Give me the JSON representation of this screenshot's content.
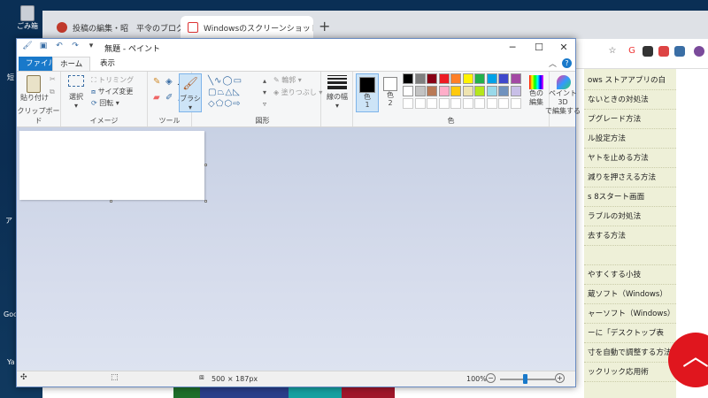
{
  "desktop": {
    "recycle_bin_label": "ごみ箱",
    "side_labels": [
      "短",
      "ア",
      "Goo",
      "Ya"
    ]
  },
  "browser": {
    "tabs": [
      {
        "title": "投稿の編集・昭　平令のブログー・",
        "active": false
      },
      {
        "title": "Windowsのスクリーンショットの撮り方",
        "active": true
      }
    ],
    "new_tab": "+"
  },
  "webpage": {
    "items": [
      "ows ストアアプリの白",
      "ないときの対処法",
      "プグレード方法",
      "ル設定方法",
      "ヤトを止める方法",
      "減りを押さえる方法",
      "s 8スタート画面",
      "ラブルの対処法",
      "去する方法",
      "",
      "やすくする小技",
      "蔵ソフト（Windows）",
      "ャーソフト（Windows）",
      "ーに「デスクトップ表",
      "寸を自動で調整する方法",
      "ックリック応用術"
    ]
  },
  "paint": {
    "title": "無題 - ペイント",
    "window_buttons": {
      "minimize": "─",
      "maximize": "☐",
      "close": "✕"
    },
    "tabs": {
      "file": "ファイル",
      "home": "ホーム",
      "view": "表示"
    },
    "ribbon": {
      "clipboard": {
        "paste": "貼り付け",
        "group": "クリップボード"
      },
      "image": {
        "select": "選択",
        "crop": "トリミング",
        "resize": "サイズ変更",
        "rotate": "回転",
        "group": "イメージ"
      },
      "tools": {
        "group": "ツール"
      },
      "brushes": {
        "label": "ブラシ"
      },
      "shapes": {
        "outline": "輪郭",
        "fill": "塗りつぶし",
        "group": "図形"
      },
      "size": {
        "label": "線の幅"
      },
      "colors": {
        "color1": "色\n1",
        "color2": "色\n2",
        "edit": "色の\n編集",
        "group": "色",
        "palette_row1": [
          "#000000",
          "#7f7f7f",
          "#880015",
          "#ed1c24",
          "#ff7f27",
          "#fff200",
          "#22b14c",
          "#00a2e8",
          "#3f48cc",
          "#a349a4"
        ],
        "palette_row2": [
          "#ffffff",
          "#c3c3c3",
          "#b97a57",
          "#ffaec9",
          "#ffc90e",
          "#efe4b0",
          "#b5e61d",
          "#99d9ea",
          "#7092be",
          "#c8bfe7"
        ]
      },
      "paint3d": {
        "label": "ペイント 3D\nで編集する"
      }
    },
    "status": {
      "size": "500 × 187px",
      "zoom": "100%"
    }
  }
}
